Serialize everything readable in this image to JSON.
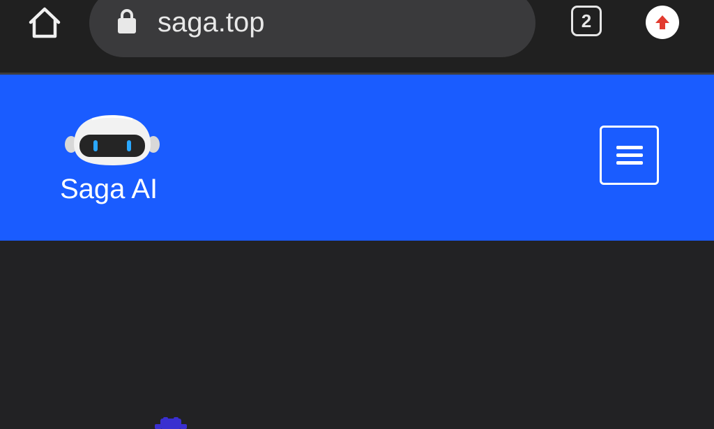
{
  "browser": {
    "url": "saga.top",
    "tab_count": "2",
    "icons": {
      "home": "home-icon",
      "lock": "lock-icon",
      "update": "arrow-up-icon"
    },
    "colors": {
      "toolbar": "#202020",
      "pill": "#3a3a3c",
      "update_arrow": "#e23b2f"
    }
  },
  "site": {
    "logo_text": "Saga AI",
    "menu_icon": "hamburger-menu-icon",
    "colors": {
      "header": "#1a5cff",
      "body": "#222224"
    }
  }
}
